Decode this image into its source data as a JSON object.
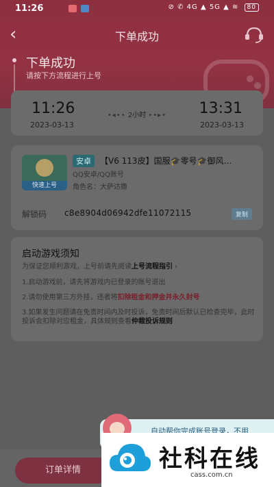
{
  "status_bar": {
    "time": "11:26",
    "indicators": "⊘ ✆ 4G ▲ 5G ▲ ≋",
    "battery": "80"
  },
  "header": {
    "back_icon": "chevron-left",
    "title": "下单成功",
    "support_icon": "headset"
  },
  "progress": {
    "title": "下单成功",
    "subtitle": "请按下方流程进行上号"
  },
  "rental": {
    "start_time": "11:26",
    "start_date": "2023-03-13",
    "duration": "2小时",
    "end_time": "13:31",
    "end_date": "2023-03-13"
  },
  "account": {
    "avatar_badge": "快速上号",
    "platform_tag": "安卓",
    "title": "【V6 113皮】国服🎓零号🎓御风…",
    "account_type": "QQ安卓/QQ账号",
    "role_name": "角色名：大萨达撒",
    "unlock_label": "解锁码",
    "unlock_code": "c8e8904d06942dfe11072115",
    "copy_label": "复制"
  },
  "notice": {
    "title": "启动游戏须知",
    "subtitle_prefix": "为保证您顺利游戏，上号前请先阅读",
    "subtitle_link": "上号流程指引",
    "item1": "1.启动游戏前，请先将游戏内已登录的账号退出",
    "item2_prefix": "2.请勿使用第三方外挂，违者将",
    "item2_highlight": "扣除租金和押金并永久封号",
    "item3_text": "3.如果发生问题请在免责时间内及时投诉，免责时间后默认已检查完毕，此时投诉会扣除对应租金，具体规则查看",
    "item3_link": "仲裁投诉规则"
  },
  "bottom": {
    "order_details": "订单详情"
  },
  "popup": {
    "text": "自动帮你完成账号登录，不用"
  },
  "watermark": {
    "name": "社科在线",
    "url": "cass.com.cn"
  },
  "colors": {
    "header_red": "#933243",
    "overlay_gray": "#5e5e5e",
    "highlight_red": "#7a1f2c"
  }
}
